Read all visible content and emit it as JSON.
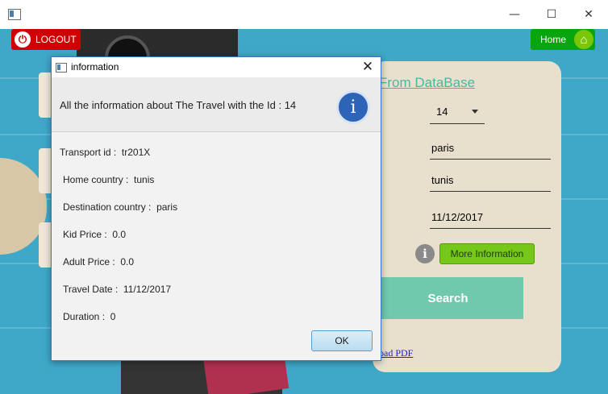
{
  "window": {
    "minimize_glyph": "—",
    "maximize_glyph": "☐",
    "close_glyph": "✕"
  },
  "toolbar": {
    "logout_label": "LOGOUT",
    "home_label": "Home"
  },
  "panel": {
    "title": "From DataBase",
    "id_value": "14",
    "destination_value": "paris",
    "home_country_value": "tunis",
    "date_value": "11/12/2017",
    "more_info_label": "More Information",
    "search_label": "Search",
    "pdf_link": "oad PDF",
    "colon": ":"
  },
  "dialog": {
    "title": "information",
    "close_glyph": "✕",
    "header_text": "All the information about The Travel with the Id : 14",
    "info_glyph": "i",
    "rows": [
      {
        "label": "Transport id :",
        "value": "tr201X"
      },
      {
        "label": "Home country :",
        "value": "tunis"
      },
      {
        "label": "Destination country :",
        "value": "paris"
      },
      {
        "label": "Kid Price :",
        "value": "0.0"
      },
      {
        "label": "Adult Price :",
        "value": "0.0"
      },
      {
        "label": "Travel Date :",
        "value": "11/12/2017"
      },
      {
        "label": "Duration :",
        "value": "0"
      }
    ],
    "ok_label": "OK"
  },
  "icons": {
    "logout": "power-icon",
    "home": "home-icon",
    "info": "info-icon"
  },
  "colors": {
    "logout_bg": "#d00000",
    "home_bg": "#09a50e",
    "search_bg": "#70c8ad",
    "dialog_border": "#3b78c4",
    "info_icon": "#2e64b8"
  }
}
